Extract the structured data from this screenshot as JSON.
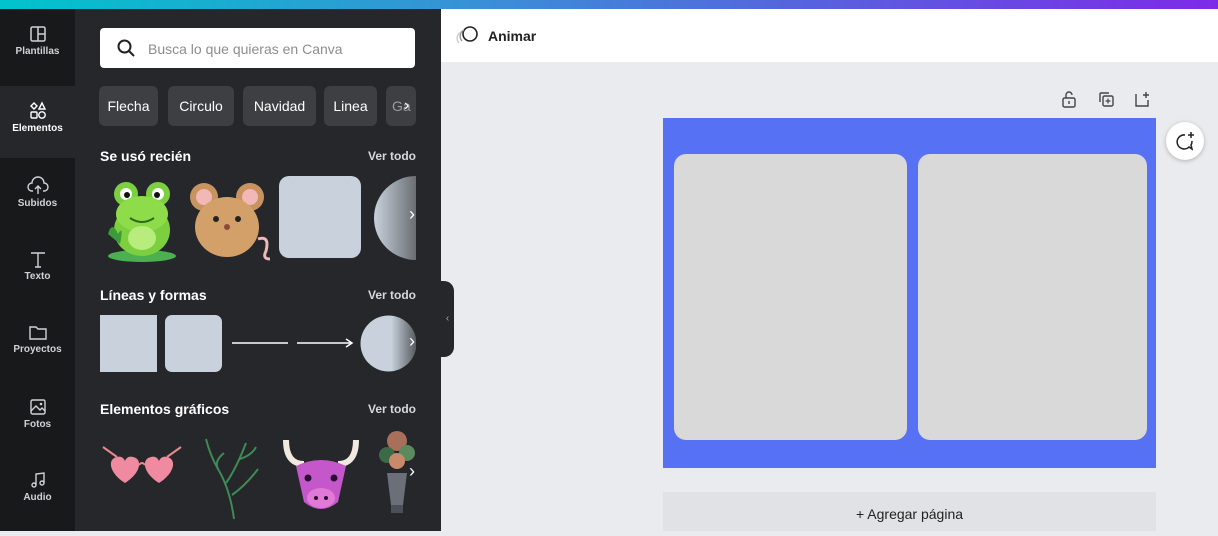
{
  "sidebar": {
    "items": [
      {
        "label": "Plantillas",
        "icon": "layout-icon"
      },
      {
        "label": "Elementos",
        "icon": "shapes-icon",
        "active": true
      },
      {
        "label": "Subidos",
        "icon": "cloud-upload-icon"
      },
      {
        "label": "Texto",
        "icon": "text-icon"
      },
      {
        "label": "Proyectos",
        "icon": "folder-icon"
      },
      {
        "label": "Fotos",
        "icon": "image-icon"
      },
      {
        "label": "Audio",
        "icon": "music-icon"
      }
    ]
  },
  "panel": {
    "search_placeholder": "Busca lo que quieras en Canva",
    "chips": [
      "Flecha",
      "Circulo",
      "Navidad",
      "Linea",
      "Ga"
    ],
    "sections": [
      {
        "title": "Se usó recién",
        "link": "Ver todo"
      },
      {
        "title": "Líneas y formas",
        "link": "Ver todo"
      },
      {
        "title": "Elementos gráficos",
        "link": "Ver todo"
      }
    ]
  },
  "topbar": {
    "animate_label": "Animar"
  },
  "canvas": {
    "add_page_label": "+ Agregar página"
  },
  "colors": {
    "page_background": "#5771f5",
    "frame": "#d9d9d9",
    "sidebar": "#18191b",
    "panel": "#25272a"
  }
}
